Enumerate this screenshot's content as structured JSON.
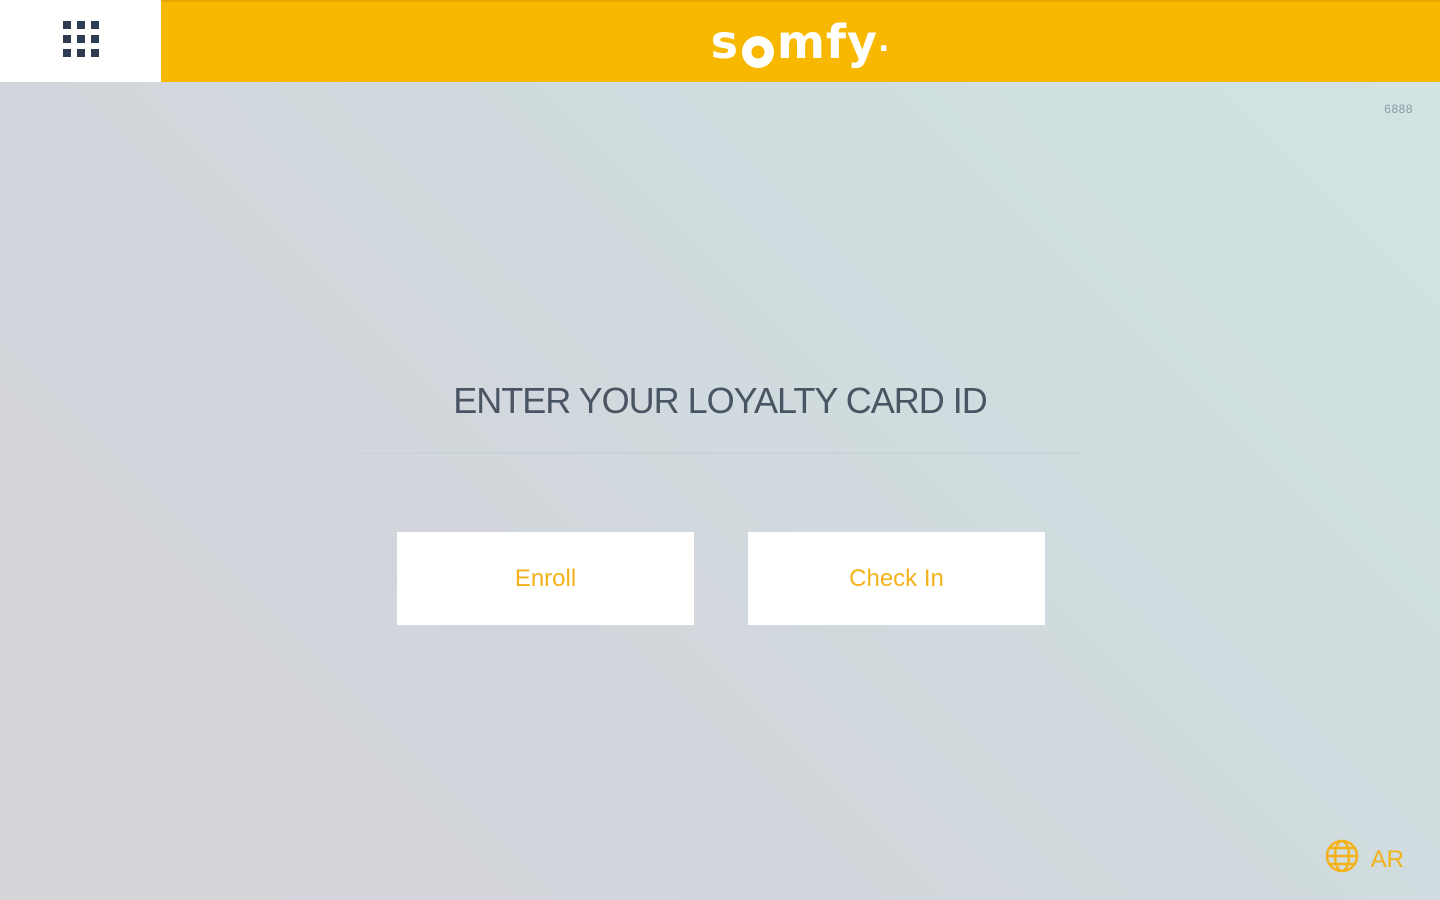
{
  "header": {
    "menu_icon": "grid-icon",
    "brand": {
      "before_o": "s",
      "after_o": "mfy",
      "trailing_dot": ".",
      "bar_color": "#f9b800"
    }
  },
  "terminal_id": "6888",
  "prompt": {
    "title": "ENTER YOUR LOYALTY CARD ID",
    "input_value": "",
    "input_placeholder": ""
  },
  "actions": {
    "enroll_label": "Enroll",
    "checkin_label": "Check In",
    "accent_color": "#f4b21a"
  },
  "language": {
    "icon": "globe-icon",
    "label": "AR"
  }
}
